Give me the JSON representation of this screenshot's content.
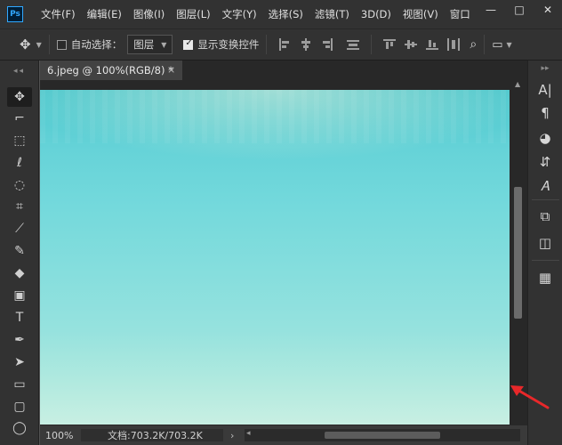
{
  "app": {
    "logo_text": "Ps"
  },
  "menu": [
    "文件(F)",
    "编辑(E)",
    "图像(I)",
    "图层(L)",
    "文字(Y)",
    "选择(S)",
    "滤镜(T)",
    "3D(D)",
    "视图(V)",
    "窗口"
  ],
  "window_controls": {
    "minimize": "—",
    "restore": "□",
    "close": "✕"
  },
  "options_bar": {
    "auto_select_label": "自动选择：",
    "auto_select_checked": false,
    "auto_select_target": "图层",
    "show_transform_label": "显示变换控件",
    "show_transform_checked": true
  },
  "document_tab": {
    "title": "6.jpeg @ 100%(RGB/8) *",
    "close": "×"
  },
  "status_bar": {
    "zoom": "100%",
    "doc_info": "文档:703.2K/703.2K",
    "arrow": "›"
  },
  "toolbar_grip": "◂◂",
  "tools": [
    {
      "name": "move-tool",
      "glyph": "✥"
    },
    {
      "name": "artboard-tool",
      "glyph": "⌐"
    },
    {
      "name": "marquee-tool",
      "glyph": "⬚"
    },
    {
      "name": "lasso-tool",
      "glyph": "ℓ"
    },
    {
      "name": "quick-selection-tool",
      "glyph": "◌"
    },
    {
      "name": "crop-tool",
      "glyph": "⌗"
    },
    {
      "name": "eyedropper-tool",
      "glyph": "⟋"
    },
    {
      "name": "brush-tool",
      "glyph": "✎"
    },
    {
      "name": "eraser-tool",
      "glyph": "◆"
    },
    {
      "name": "gradient-tool",
      "glyph": "▣"
    },
    {
      "name": "type-tool",
      "glyph": "T"
    },
    {
      "name": "pen-tool",
      "glyph": "✒"
    },
    {
      "name": "path-selection-tool",
      "glyph": "➤"
    },
    {
      "name": "rectangle-tool",
      "glyph": "▭"
    },
    {
      "name": "rounded-rectangle-tool",
      "glyph": "▢"
    },
    {
      "name": "ellipse-tool",
      "glyph": "◯"
    }
  ],
  "right_panel_icons": [
    {
      "name": "character-panel-icon",
      "glyph": "A|"
    },
    {
      "name": "paragraph-panel-icon",
      "glyph": "¶"
    },
    {
      "name": "swatches-panel-icon",
      "glyph": "◕"
    },
    {
      "name": "glyphs-panel-icon",
      "glyph": "⇵"
    },
    {
      "name": "character-styles-icon",
      "glyph": "𝐴"
    },
    {
      "name": "3d-panel-icon",
      "glyph": "⧉"
    },
    {
      "name": "properties-panel-icon",
      "glyph": "◫"
    },
    {
      "name": "table-grid-icon",
      "glyph": "▦"
    }
  ],
  "colors": {
    "accent_ps": "#31a8ff",
    "annotation_arrow": "#e8282a"
  }
}
